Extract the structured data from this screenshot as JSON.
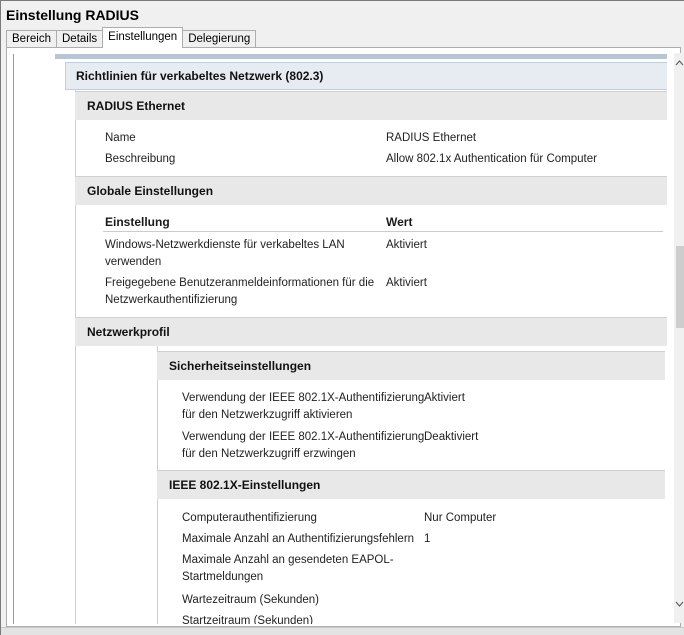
{
  "window": {
    "title": "Einstellung RADIUS"
  },
  "tabs": [
    {
      "label": "Bereich",
      "active": false
    },
    {
      "label": "Details",
      "active": false
    },
    {
      "label": "Einstellungen",
      "active": true
    },
    {
      "label": "Delegierung",
      "active": false
    }
  ],
  "report": {
    "section_title": "Richtlinien für verkabeltes Netzwerk (802.3)",
    "radius_ethernet": {
      "heading": "RADIUS Ethernet",
      "rows": [
        {
          "label": "Name",
          "value": "RADIUS Ethernet"
        },
        {
          "label": "Beschreibung",
          "value": "Allow 802.1x Authentication für Computer"
        }
      ]
    },
    "global_settings": {
      "heading": "Globale Einstellungen",
      "col_setting": "Einstellung",
      "col_value": "Wert",
      "rows": [
        {
          "label_1": "Windows-Netzwerkdienste für verkabeltes LAN",
          "label_2": "verwenden",
          "value": "Aktiviert"
        },
        {
          "label_1": "Freigegebene Benutzeranmeldeinformationen für die",
          "label_2": "Netzwerkauthentifizierung",
          "value": "Aktiviert"
        }
      ]
    },
    "network_profile": {
      "heading": "Netzwerkprofil",
      "security": {
        "heading": "Sicherheitseinstellungen",
        "rows": [
          {
            "label_1": "Verwendung der IEEE 802.1X-Authentifizierung",
            "label_2": "für den Netzwerkzugriff aktivieren",
            "value": "Aktiviert"
          },
          {
            "label_1": "Verwendung der IEEE 802.1X-Authentifizierung",
            "label_2": "für den Netzwerkzugriff erzwingen",
            "value": "Deaktiviert"
          }
        ]
      },
      "ieee": {
        "heading": "IEEE 802.1X-Einstellungen",
        "rows": [
          {
            "label_1": "Computerauthentifizierung",
            "label_2": "",
            "value": "Nur Computer"
          },
          {
            "label_1": "Maximale Anzahl an Authentifizierungsfehlern",
            "label_2": "",
            "value": "1"
          },
          {
            "label_1": "Maximale Anzahl an gesendeten EAPOL-",
            "label_2": "Startmeldungen",
            "value": ""
          },
          {
            "label_1": "Wartezeitraum (Sekunden)",
            "label_2": "",
            "value": ""
          },
          {
            "label_1": "Startzeitraum (Sekunden)",
            "label_2": "",
            "value": ""
          }
        ]
      }
    }
  },
  "colors": {
    "section_header": "#e6ecf2",
    "subsection_header": "#e8e8e8",
    "accent_bar": "#b8c6d4"
  }
}
